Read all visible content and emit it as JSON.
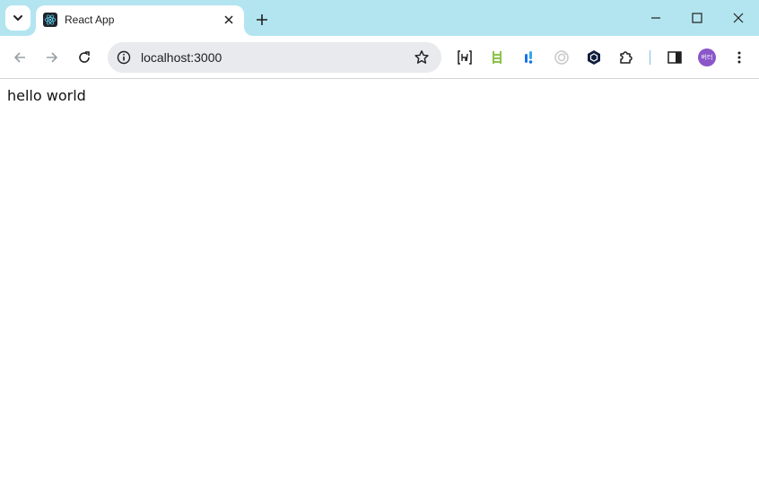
{
  "browser": {
    "tab": {
      "title": "React App",
      "favicon": "react-logo-icon"
    },
    "address_bar": {
      "url": "localhost:3000"
    },
    "profile": {
      "initials": "버터",
      "color": "#8a56c9"
    },
    "colors": {
      "titlebar": "#b3e5f0",
      "omnibox": "#e8eaed"
    }
  },
  "page": {
    "text": "hello world"
  }
}
